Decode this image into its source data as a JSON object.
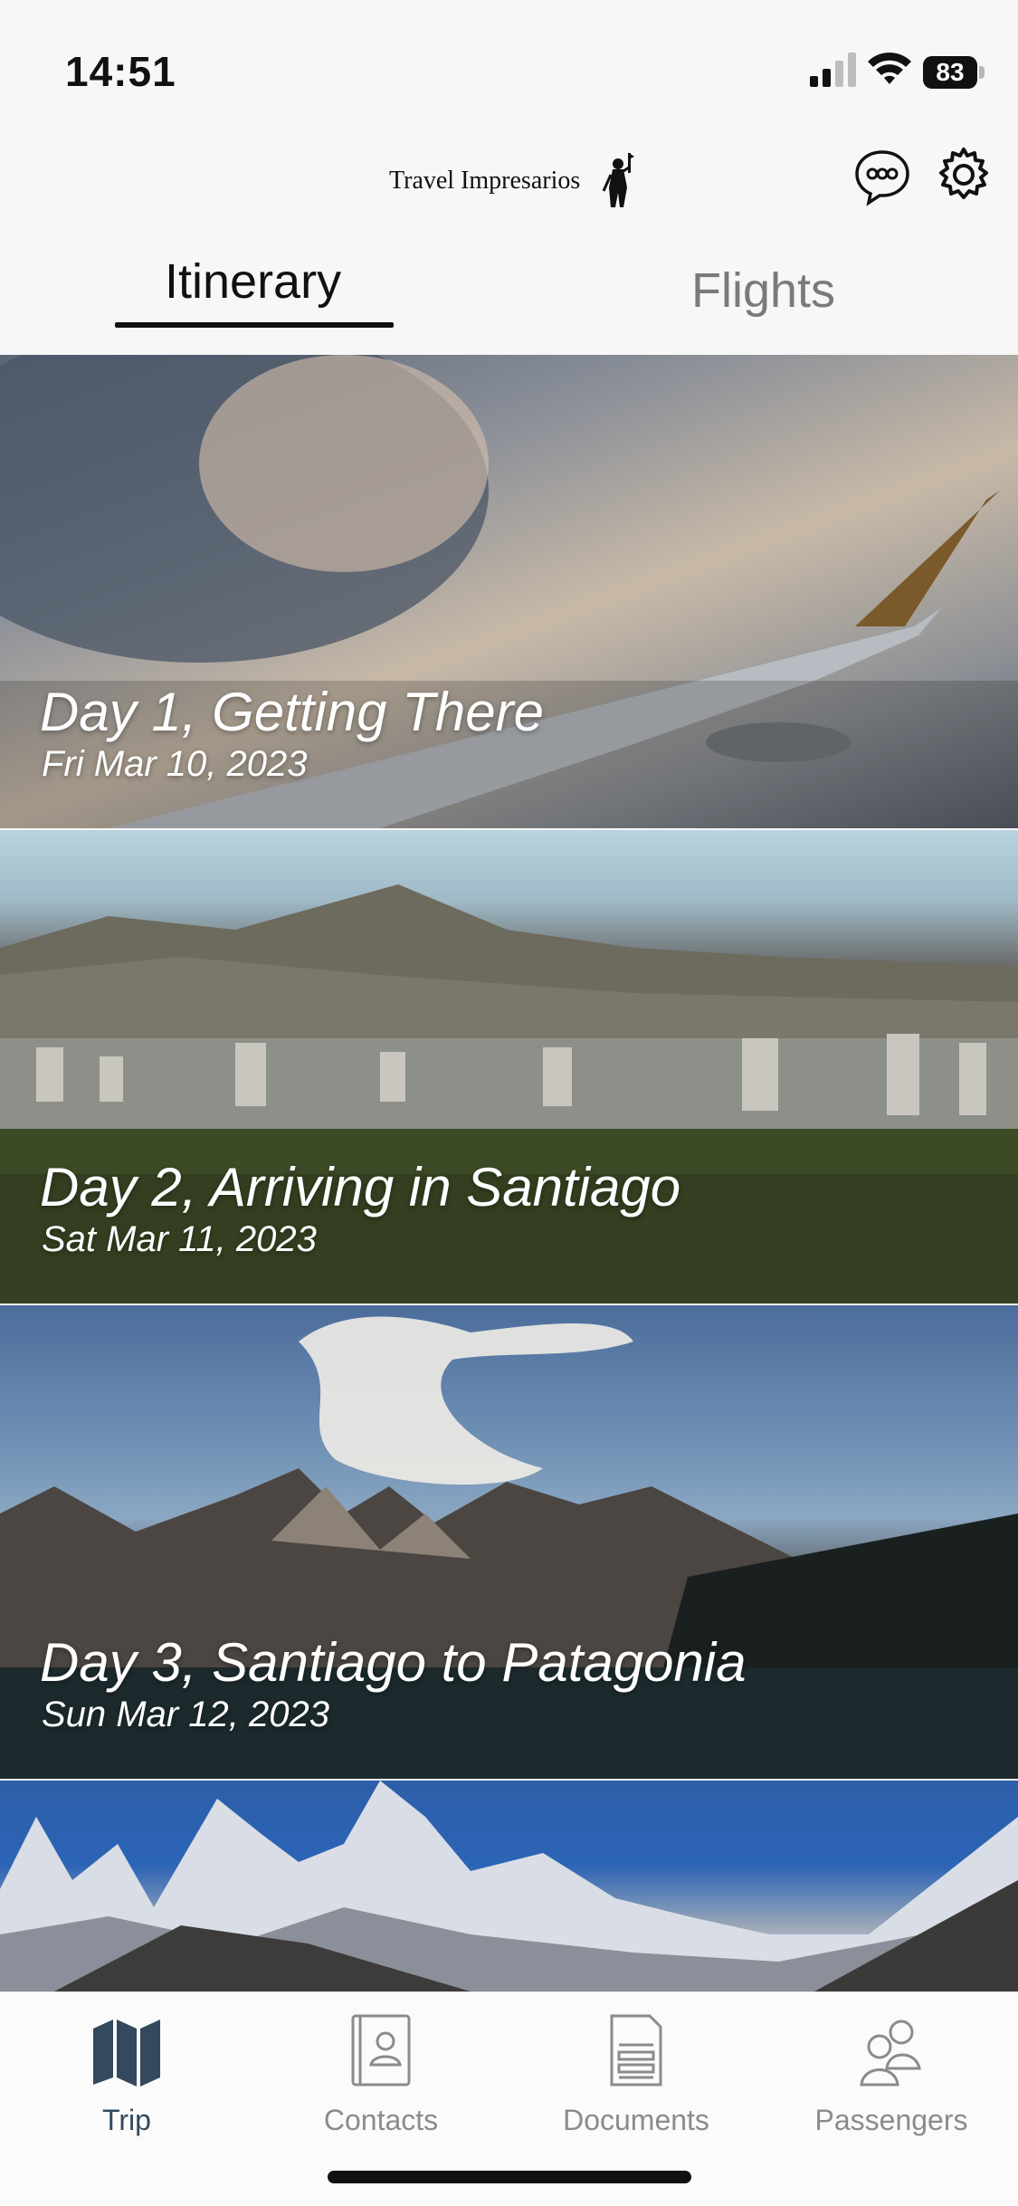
{
  "status_bar": {
    "time": "14:51",
    "battery": "83"
  },
  "header": {
    "brand": "Travel Impresarios"
  },
  "tabs": [
    {
      "label": "Itinerary",
      "active": true
    },
    {
      "label": "Flights",
      "active": false
    }
  ],
  "itinerary": [
    {
      "title": "Day 1, Getting There",
      "date": "Fri Mar 10, 2023"
    },
    {
      "title": "Day 2, Arriving in Santiago",
      "date": "Sat Mar 11, 2023"
    },
    {
      "title": "Day 3, Santiago to Patagonia",
      "date": "Sun Mar 12, 2023"
    }
  ],
  "tab_bar": [
    {
      "label": "Trip",
      "icon": "map-icon",
      "active": true
    },
    {
      "label": "Contacts",
      "icon": "contacts-book-icon",
      "active": false
    },
    {
      "label": "Documents",
      "icon": "document-icon",
      "active": false
    },
    {
      "label": "Passengers",
      "icon": "people-icon",
      "active": false
    }
  ],
  "colors": {
    "accent": "#34495e",
    "inactive": "#8b8b8b"
  }
}
